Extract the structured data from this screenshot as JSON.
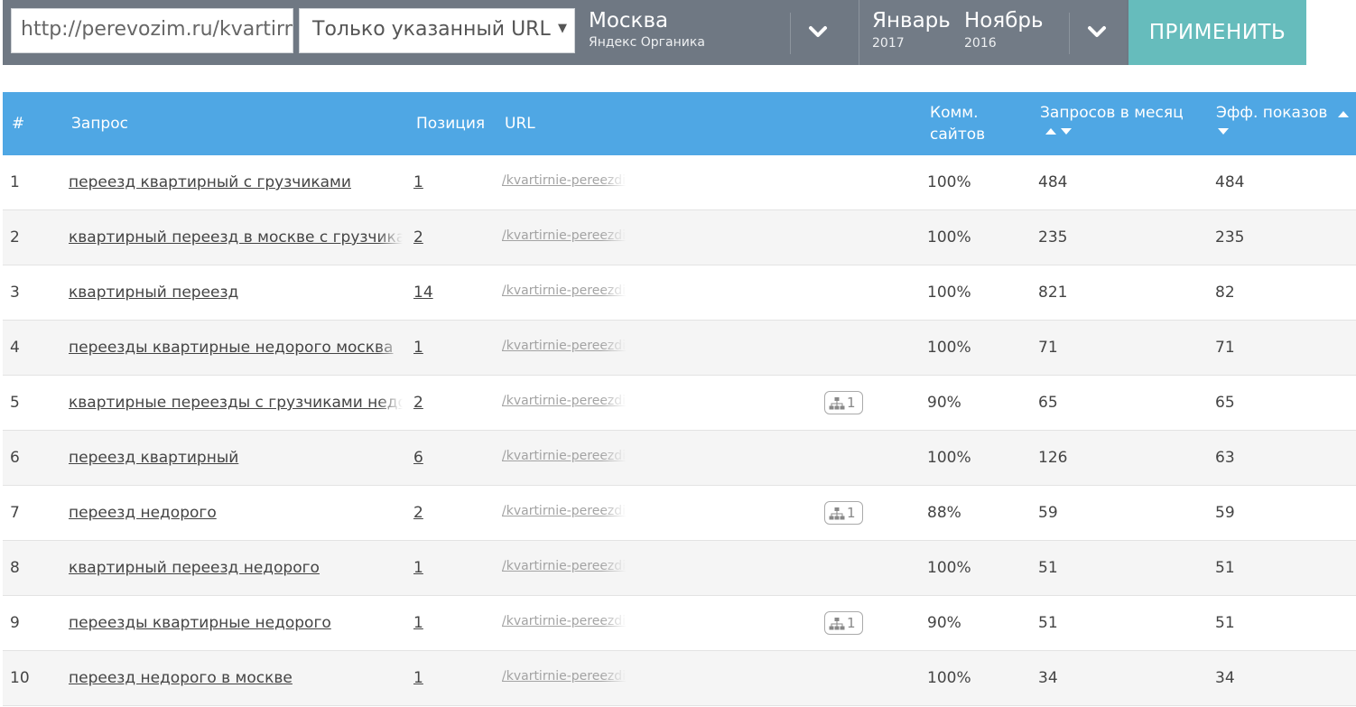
{
  "toolbar": {
    "url_value": "http://perevozim.ru/kvartirnie-pereezdi",
    "mode_select": "Только указанный URL",
    "region_city": "Москва",
    "region_engine": "Яндекс Органика",
    "period_from_month": "Январь",
    "period_from_year": "2017",
    "period_to_month": "Ноябрь",
    "period_to_year": "2016",
    "apply_label": "ПРИМЕНИТЬ"
  },
  "table": {
    "headers": {
      "num": "#",
      "query": "Запрос",
      "position": "Позиция",
      "url": "URL",
      "comm_line1": "Комм.",
      "comm_line2": "сайтов",
      "requests": "Запросов в месяц",
      "eff": "Эфф. показов"
    },
    "rows": [
      {
        "num": "1",
        "query": "переезд квартирный с грузчиками",
        "position": "1",
        "url": "/kvartirnie-pereezdi",
        "badge": "",
        "comm": "100%",
        "requests": "484",
        "eff": "484"
      },
      {
        "num": "2",
        "query": "квартирный переезд в москве с грузчиками",
        "position": "2",
        "url": "/kvartirnie-pereezdi",
        "badge": "",
        "comm": "100%",
        "requests": "235",
        "eff": "235"
      },
      {
        "num": "3",
        "query": "квартирный переезд",
        "position": "14",
        "url": "/kvartirnie-pereezdi",
        "badge": "",
        "comm": "100%",
        "requests": "821",
        "eff": "82"
      },
      {
        "num": "4",
        "query": "переезды квартирные недорого москва",
        "position": "1",
        "url": "/kvartirnie-pereezdi",
        "badge": "",
        "comm": "100%",
        "requests": "71",
        "eff": "71"
      },
      {
        "num": "5",
        "query": "квартирные переезды с грузчиками недорого",
        "position": "2",
        "url": "/kvartirnie-pereezdi",
        "badge": "1",
        "comm": "90%",
        "requests": "65",
        "eff": "65"
      },
      {
        "num": "6",
        "query": "переезд квартирный",
        "position": "6",
        "url": "/kvartirnie-pereezdi",
        "badge": "",
        "comm": "100%",
        "requests": "126",
        "eff": "63"
      },
      {
        "num": "7",
        "query": "переезд недорого",
        "position": "2",
        "url": "/kvartirnie-pereezdi",
        "badge": "1",
        "comm": "88%",
        "requests": "59",
        "eff": "59"
      },
      {
        "num": "8",
        "query": "квартирный переезд недорого",
        "position": "1",
        "url": "/kvartirnie-pereezdi",
        "badge": "",
        "comm": "100%",
        "requests": "51",
        "eff": "51"
      },
      {
        "num": "9",
        "query": "переезды квартирные недорого",
        "position": "1",
        "url": "/kvartirnie-pereezdi",
        "badge": "1",
        "comm": "90%",
        "requests": "51",
        "eff": "51"
      },
      {
        "num": "10",
        "query": "переезд недорого в москве",
        "position": "1",
        "url": "/kvartirnie-pereezdi",
        "badge": "",
        "comm": "100%",
        "requests": "34",
        "eff": "34"
      }
    ]
  },
  "icons": {
    "chevron": "chevron-down-icon",
    "sort_up": "sort-up-icon",
    "sort_down": "sort-down-icon",
    "sitemap": "sitemap-icon"
  },
  "colors": {
    "toolbar_bg": "#6f7883",
    "header_bg": "#4fa7e4",
    "apply_bg": "#66bcbc",
    "row_alt": "#f5f5f5"
  }
}
